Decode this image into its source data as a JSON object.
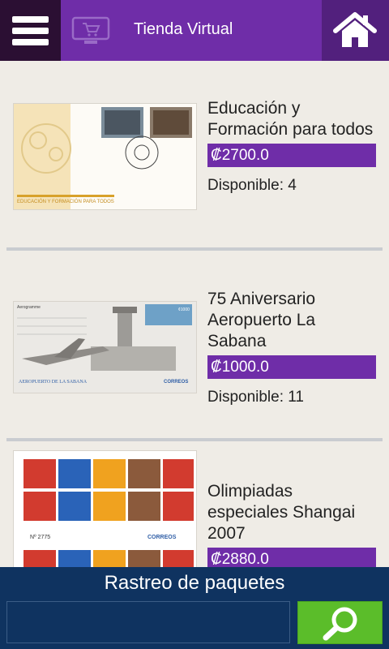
{
  "header": {
    "title": "Tienda Virtual",
    "menu_icon": "hamburger-menu-icon",
    "cart_icon": "shopping-cart-icon",
    "home_icon": "home-icon"
  },
  "colors": {
    "header_purple": "#6f2da8",
    "menu_dark": "#2b0f33",
    "price_purple": "#6f2da8",
    "footer_navy": "#0f3360",
    "search_green": "#5bbd2a",
    "background": "#efece6"
  },
  "products": [
    {
      "name": "Educación y Formación para todos",
      "price": "₡2700.0",
      "availability": "Disponible: 4"
    },
    {
      "name": "75 Aniversario Aeropuerto La Sabana",
      "price": "₡1000.0",
      "availability": "Disponible: 11"
    },
    {
      "name": "Olimpiadas especiales Shangai 2007",
      "price": "₡2880.0",
      "availability": ""
    }
  ],
  "thumbnails": {
    "education_banner": "EDUCACIÓN Y FORMACIÓN PARA TODOS",
    "airport_heading": "Aerogramme",
    "airport_caption": "AEROPUERTO DE LA SABANA",
    "airport_value": "¢1000",
    "correos": "CORREOS",
    "olympics_number": "Nº 2775"
  },
  "footer": {
    "title": "Rastreo de paquetes",
    "input_value": "",
    "input_placeholder": "",
    "search_icon": "search-icon"
  }
}
